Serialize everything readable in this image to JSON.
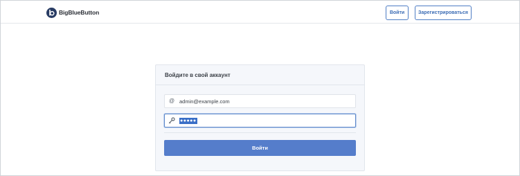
{
  "header": {
    "brand_name": "BigBlueButton",
    "login_label": "Войти",
    "register_label": "Зарегистрироваться"
  },
  "login_card": {
    "title": "Войдите в свой аккаунт",
    "email_icon": "@",
    "email_value": "admin@example.com",
    "password_icon": "key-icon",
    "password_mask": "●●●●●",
    "submit_label": "Войти"
  },
  "colors": {
    "brand_dark": "#283b63",
    "accent": "#557dcb",
    "outline_button": "#4d7cc4",
    "card_bg": "#f5f7fb"
  }
}
